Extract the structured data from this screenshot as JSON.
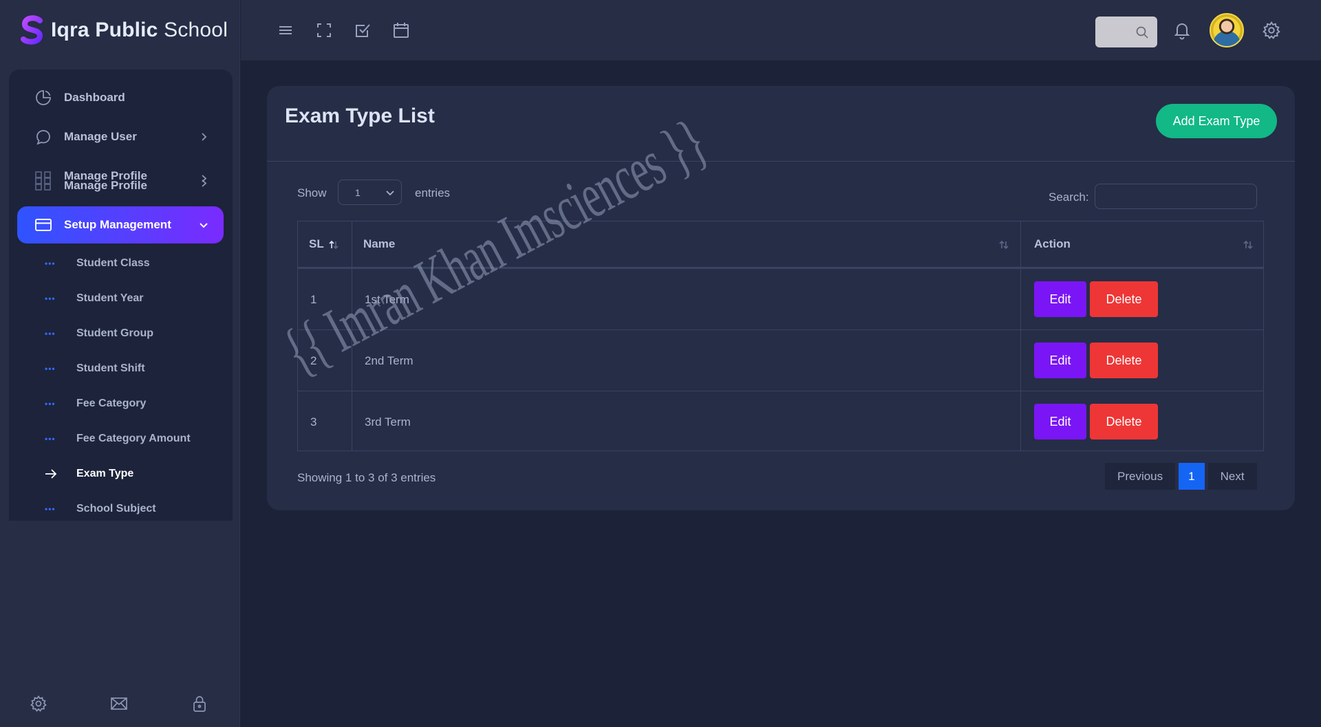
{
  "app": {
    "brand_bold": "Iqra Public",
    "brand_light": "School"
  },
  "sidebar": {
    "items": [
      {
        "label": "Dashboard",
        "icon": "pie-chart-icon"
      },
      {
        "label": "Manage User",
        "icon": "chat-bubble-icon"
      },
      {
        "label": "Manage Profile",
        "label2": "Manage Profile",
        "icon": "grid-icon"
      },
      {
        "label": "Setup Management",
        "icon": "credit-card-icon"
      }
    ],
    "sub_items": [
      {
        "label": "Student Class"
      },
      {
        "label": "Student Year"
      },
      {
        "label": "Student Group"
      },
      {
        "label": "Student Shift"
      },
      {
        "label": "Fee Category"
      },
      {
        "label": "Fee Category Amount"
      },
      {
        "label": "Exam Type"
      },
      {
        "label": "School Subject"
      }
    ],
    "footer_icons": [
      "settings-icon",
      "mail-icon",
      "lock-icon"
    ]
  },
  "topbar": {
    "icons": [
      "menu-icon",
      "fullscreen-icon",
      "checkbox-icon",
      "calendar-icon",
      "search-icon",
      "bell-icon",
      "settings-icon"
    ]
  },
  "card": {
    "title": "Exam Type List",
    "add_button": "Add Exam Type"
  },
  "table_controls": {
    "show_label": "Show",
    "entries_value": "1",
    "entries_label": "entries",
    "search_label": "Search:",
    "search_value": ""
  },
  "table": {
    "columns": [
      "SL",
      "Name",
      "Action"
    ],
    "rows": [
      {
        "sl": "1",
        "name": "1st Term"
      },
      {
        "sl": "2",
        "name": "2nd Term"
      },
      {
        "sl": "3",
        "name": "3rd Term"
      }
    ],
    "edit_label": "Edit",
    "delete_label": "Delete"
  },
  "footer": {
    "info": "Showing 1 to 3 of 3 entries",
    "previous": "Previous",
    "current_page": "1",
    "next": "Next"
  },
  "watermark": "{{ Imran Khan Imsciences }}",
  "colors": {
    "accent_gradient_start": "#2f54ff",
    "accent_gradient_end": "#7a2bff",
    "add_button": "#12b886",
    "edit_button": "#7a16f5",
    "delete_button": "#ee3636",
    "pager_active": "#1565f5"
  }
}
